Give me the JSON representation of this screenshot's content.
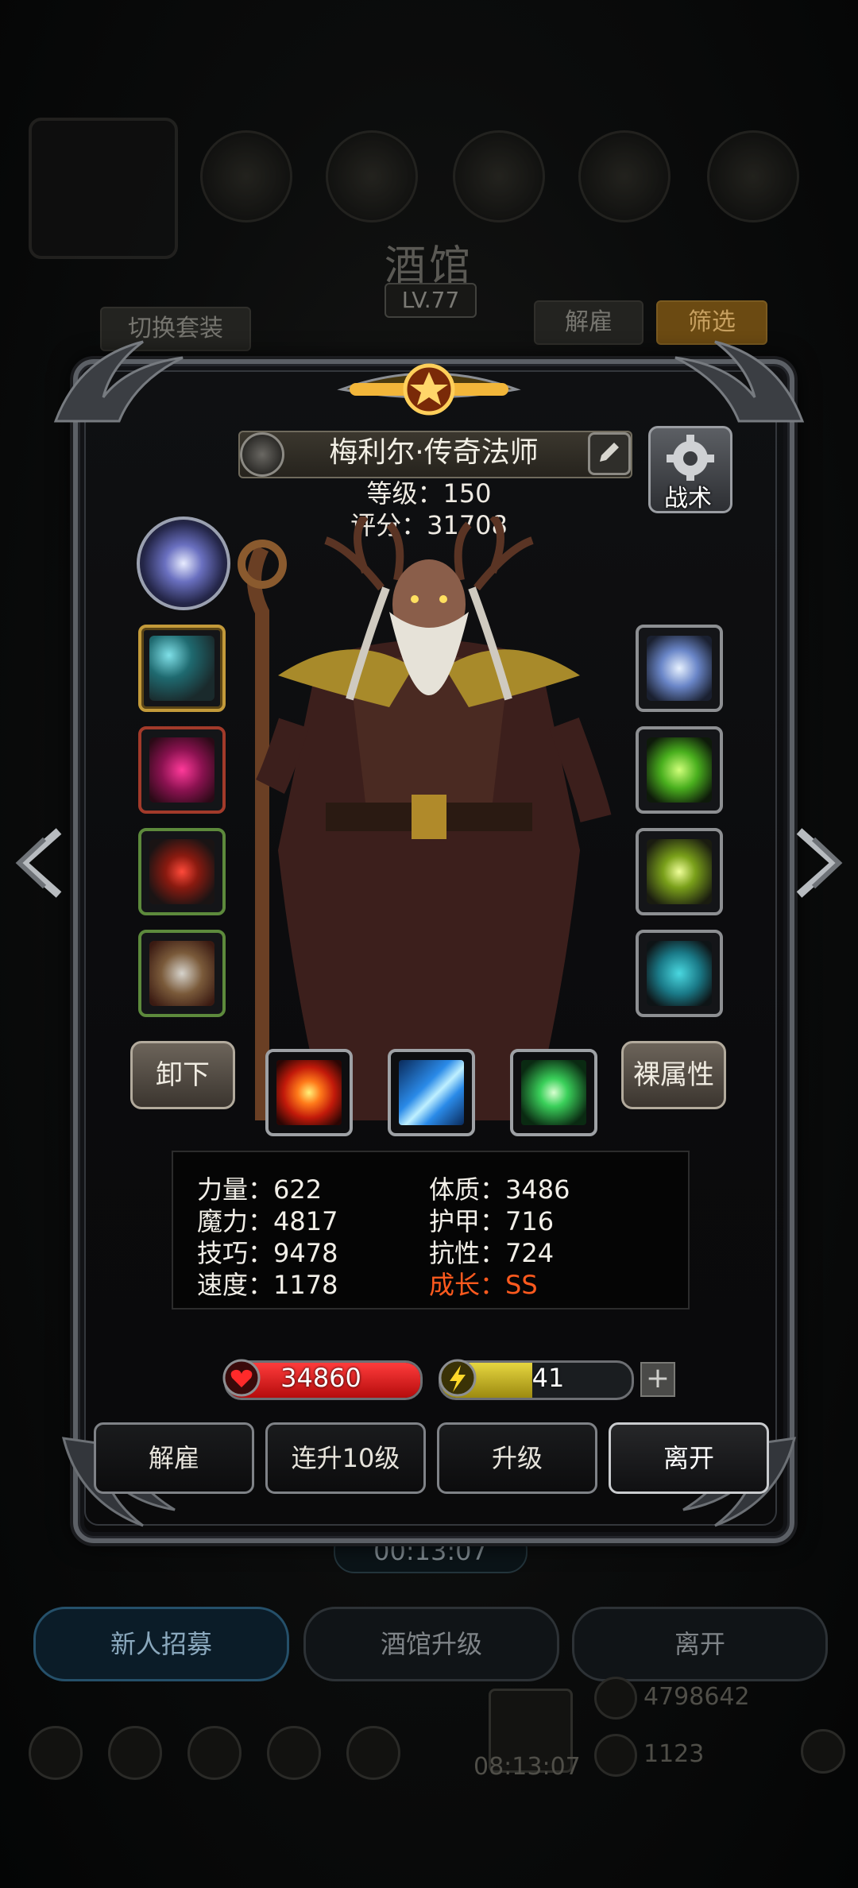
{
  "background": {
    "title": "酒馆",
    "level": "LV.77",
    "switch_outfit": "切换套装",
    "dismiss_tab": "解雇",
    "filter_tab": "筛选",
    "timer": "00:13:07",
    "recruit_button": "新人招募",
    "upgrade_tavern_button": "酒馆升级",
    "leave_button": "离开",
    "gold_count": "4798642",
    "gem_count": "1123",
    "clock": "08:13:07"
  },
  "hero": {
    "name": "梅利尔·传奇法师",
    "level_line": "等级：150",
    "score_line": "评分：31708",
    "tactics_label": "战术",
    "unequip_label": "卸下",
    "naked_attr_label": "裸属性"
  },
  "stats": {
    "left": [
      "力量：622",
      "魔力：4817",
      "技巧：9478",
      "速度：1178"
    ],
    "right": [
      "体质：3486",
      "护甲：716",
      "抗性：724",
      "成长：SS"
    ]
  },
  "bars": {
    "hp_value": "34860",
    "hp_fraction": 1.0,
    "energy_value": "41",
    "energy_fraction": 0.48,
    "plus_label": "+"
  },
  "actions": {
    "dismiss": "解雇",
    "level_up_10": "连升10级",
    "level_up": "升级",
    "leave": "离开"
  },
  "equipment_left": [
    "staff-icon",
    "robe-icon",
    "amulet-icon",
    "shield-icon"
  ],
  "equipment_right": [
    "crown-icon",
    "gem-icon",
    "lantern-icon",
    "stone-icon"
  ],
  "skills": [
    "fire-burst-icon",
    "ice-shards-icon",
    "crystal-icon"
  ],
  "colors": {
    "growth": "#ff5a1e",
    "hp": "#d41a1a",
    "energy": "#d9c62e"
  }
}
